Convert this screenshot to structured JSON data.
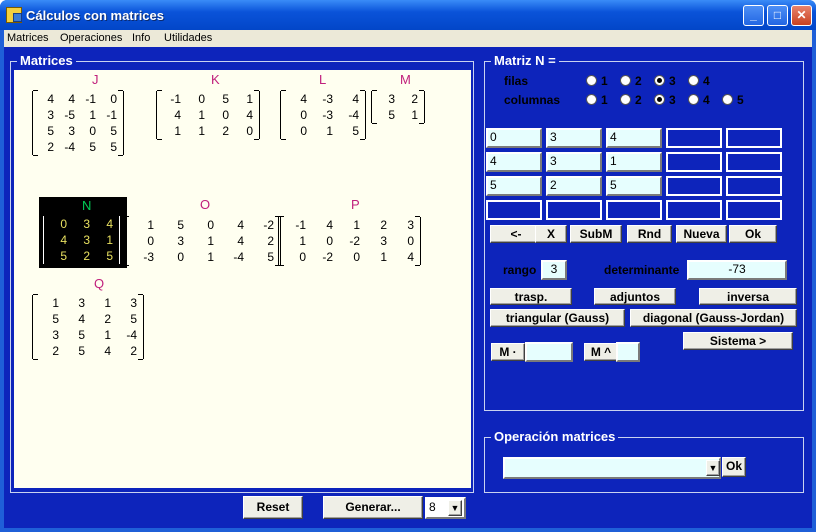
{
  "window": {
    "title": "Cálculos con matrices"
  },
  "menu": [
    "Matrices",
    "Operaciones",
    "Info",
    "Utilidades"
  ],
  "matrices_panel": {
    "legend": "Matrices"
  },
  "matrices": {
    "J": {
      "name": "J",
      "rows": [
        [
          "4",
          "4",
          "-1",
          "0"
        ],
        [
          "3",
          "-5",
          "1",
          "-1"
        ],
        [
          "5",
          "3",
          "0",
          "5"
        ],
        [
          "2",
          "-4",
          "5",
          "5"
        ]
      ]
    },
    "K": {
      "name": "K",
      "rows": [
        [
          "-1",
          "0",
          "5",
          "1"
        ],
        [
          "4",
          "1",
          "0",
          "4"
        ],
        [
          "1",
          "1",
          "2",
          "0"
        ]
      ]
    },
    "L": {
      "name": "L",
      "rows": [
        [
          "4",
          "-3",
          "4"
        ],
        [
          "0",
          "-3",
          "-4"
        ],
        [
          "0",
          "1",
          "5"
        ]
      ]
    },
    "M": {
      "name": "M",
      "rows": [
        [
          "3",
          "2"
        ],
        [
          "5",
          "1"
        ]
      ]
    },
    "N": {
      "name": "N",
      "rows": [
        [
          "0",
          "3",
          "4"
        ],
        [
          "4",
          "3",
          "1"
        ],
        [
          "5",
          "2",
          "5"
        ]
      ]
    },
    "O": {
      "name": "O",
      "rows": [
        [
          "1",
          "5",
          "0",
          "4",
          "-2"
        ],
        [
          "0",
          "3",
          "1",
          "4",
          "2"
        ],
        [
          "-3",
          "0",
          "1",
          "-4",
          "5"
        ]
      ]
    },
    "P": {
      "name": "P",
      "rows": [
        [
          "-1",
          "4",
          "1",
          "2",
          "3"
        ],
        [
          "1",
          "0",
          "-2",
          "3",
          "0"
        ],
        [
          "0",
          "-2",
          "0",
          "1",
          "4"
        ]
      ]
    },
    "Q": {
      "name": "Q",
      "rows": [
        [
          "1",
          "3",
          "1",
          "3"
        ],
        [
          "5",
          "4",
          "2",
          "5"
        ],
        [
          "3",
          "5",
          "1",
          "-4"
        ],
        [
          "2",
          "5",
          "4",
          "2"
        ]
      ]
    }
  },
  "editor": {
    "legend": "Matriz  N =",
    "filas_label": "filas",
    "columnas_label": "columnas",
    "filas_options": [
      "1",
      "2",
      "3",
      "4"
    ],
    "filas_selected": "3",
    "columnas_options": [
      "1",
      "2",
      "3",
      "4",
      "5"
    ],
    "columnas_selected": "3",
    "grid": [
      [
        "0",
        "3",
        "4",
        "",
        ""
      ],
      [
        "4",
        "3",
        "1",
        "",
        ""
      ],
      [
        "5",
        "2",
        "5",
        "",
        ""
      ],
      [
        "",
        "",
        "",
        "",
        ""
      ]
    ],
    "buttons": [
      "<-",
      "X",
      "SubM",
      "Rnd",
      "Nueva",
      "Ok"
    ],
    "rango_label": "rango",
    "rango_value": "3",
    "determinante_label": "determinante",
    "determinante_value": "-73",
    "op_buttons": [
      "trasp.",
      "adjuntos",
      "inversa",
      "triangular (Gauss)",
      "diagonal (Gauss-Jordan)"
    ],
    "mult_label": "M ·",
    "pow_label": "M ^",
    "sistema_label": "Sistema >"
  },
  "ops_panel": {
    "legend": "Operación matrices",
    "ok": "Ok",
    "dropdown_value": ""
  },
  "bottom": {
    "reset": "Reset",
    "generar": "Generar...",
    "count": "8"
  }
}
